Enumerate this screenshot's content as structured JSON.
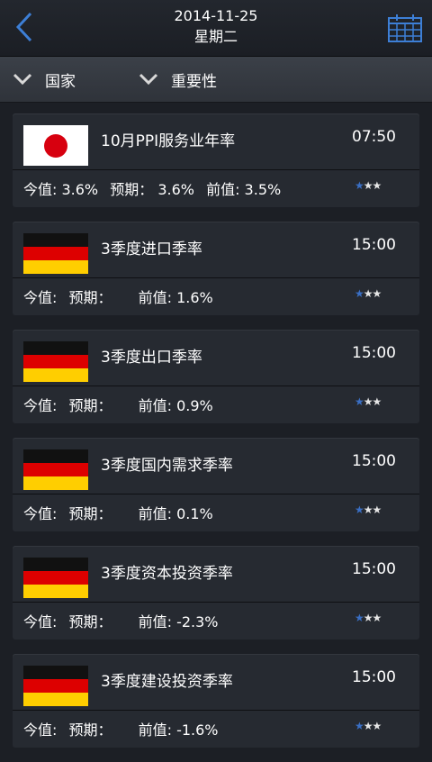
{
  "header": {
    "date": "2014-11-25",
    "weekday": "星期二"
  },
  "filters": [
    {
      "label": "国家"
    },
    {
      "label": "重要性"
    }
  ],
  "colors": {
    "accent": "#3a6fc4",
    "background": "#1c1f25",
    "card": "#262a31"
  },
  "events": [
    {
      "country_flag": "japan-flag",
      "title": "10月PPI服务业年率",
      "time": "07:50",
      "actual": "今值: 3.6%",
      "forecast": "预期：  3.6%",
      "previous": "前值: 3.5%",
      "importance": 1
    },
    {
      "country_flag": "germany-flag",
      "title": "3季度进口季率",
      "time": "15:00",
      "actual": "今值:",
      "forecast": "预期：",
      "previous": "前值: 1.6%",
      "importance": 1
    },
    {
      "country_flag": "germany-flag",
      "title": "3季度出口季率",
      "time": "15:00",
      "actual": "今值:",
      "forecast": "预期：",
      "previous": "前值: 0.9%",
      "importance": 1
    },
    {
      "country_flag": "germany-flag",
      "title": "3季度国内需求季率",
      "time": "15:00",
      "actual": "今值:",
      "forecast": "预期：",
      "previous": "前值: 0.1%",
      "importance": 1
    },
    {
      "country_flag": "germany-flag",
      "title": "3季度资本投资季率",
      "time": "15:00",
      "actual": "今值:",
      "forecast": "预期：",
      "previous": "前值: -2.3%",
      "importance": 1
    },
    {
      "country_flag": "germany-flag",
      "title": "3季度建设投资季率",
      "time": "15:00",
      "actual": "今值:",
      "forecast": "预期：",
      "previous": "前值: -1.6%",
      "importance": 1
    }
  ]
}
